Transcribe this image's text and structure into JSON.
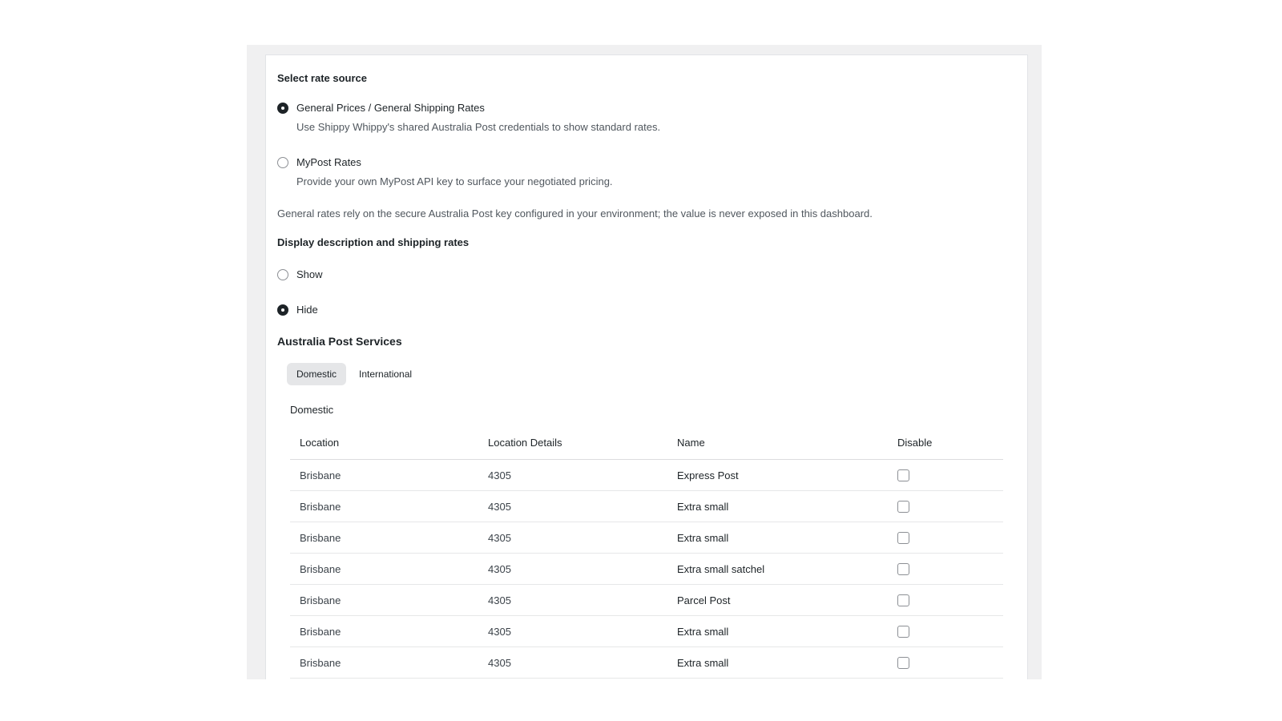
{
  "rate_source": {
    "heading": "Select rate source",
    "options": [
      {
        "label": "General Prices / General Shipping Rates",
        "description": "Use Shippy Whippy's shared Australia Post credentials to show standard rates.",
        "checked": true
      },
      {
        "label": "MyPost Rates",
        "description": "Provide your own MyPost API key to surface your negotiated pricing.",
        "checked": false
      }
    ],
    "note": "General rates rely on the secure Australia Post key configured in your environment; the value is never exposed in this dashboard."
  },
  "display": {
    "heading": "Display description and shipping rates",
    "options": [
      {
        "label": "Show",
        "checked": false
      },
      {
        "label": "Hide",
        "checked": true
      }
    ]
  },
  "services": {
    "title": "Australia Post Services",
    "tabs": [
      {
        "label": "Domestic",
        "active": true
      },
      {
        "label": "International",
        "active": false
      }
    ],
    "subtitle": "Domestic",
    "columns": [
      "Location",
      "Location Details",
      "Name",
      "Disable"
    ],
    "rows": [
      {
        "location": "Brisbane",
        "details": "4305",
        "name": "Express Post",
        "disabled": false
      },
      {
        "location": "Brisbane",
        "details": "4305",
        "name": "Extra small",
        "disabled": false
      },
      {
        "location": "Brisbane",
        "details": "4305",
        "name": "Extra small",
        "disabled": false
      },
      {
        "location": "Brisbane",
        "details": "4305",
        "name": "Extra small satchel",
        "disabled": false
      },
      {
        "location": "Brisbane",
        "details": "4305",
        "name": "Parcel Post",
        "disabled": false
      },
      {
        "location": "Brisbane",
        "details": "4305",
        "name": "Extra small",
        "disabled": false
      },
      {
        "location": "Brisbane",
        "details": "4305",
        "name": "Extra small",
        "disabled": false
      }
    ]
  }
}
